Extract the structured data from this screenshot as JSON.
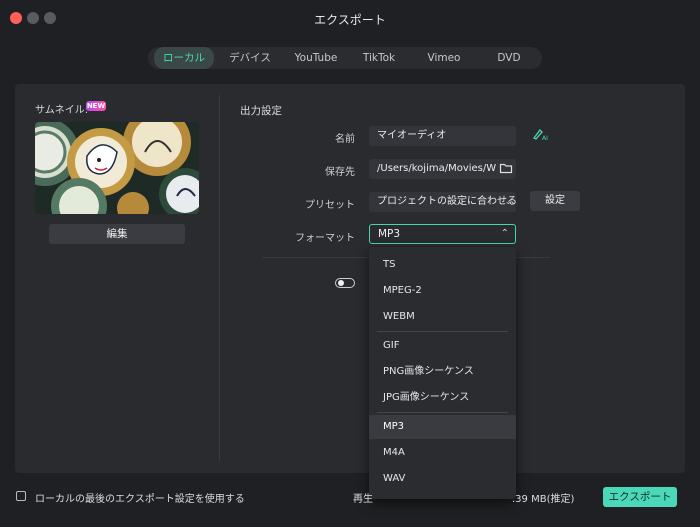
{
  "window": {
    "title": "エクスポート"
  },
  "tabs": [
    {
      "label": "ローカル",
      "active": true
    },
    {
      "label": "デバイス",
      "active": false
    },
    {
      "label": "YouTube",
      "active": false
    },
    {
      "label": "TikTok",
      "active": false
    },
    {
      "label": "Vimeo",
      "active": false
    },
    {
      "label": "DVD",
      "active": false
    }
  ],
  "left_panel": {
    "thumbnail_label": "サムネイル:",
    "new_badge": "NEW",
    "edit_button": "編集",
    "thumbnail_image": "medallion-coins-photo"
  },
  "output": {
    "section_title": "出力設定",
    "name_label": "名前",
    "name_value": "マイオーディオ",
    "save_to_label": "保存先",
    "save_to_value": "/Users/kojima/Movies/W",
    "preset_label": "プリセット",
    "preset_value": "プロジェクトの設定に合わせる",
    "settings_button": "設定",
    "format_label": "フォーマット",
    "format_value": "MP3"
  },
  "format_dropdown": {
    "options": [
      "TS",
      "MPEG-2",
      "WEBM",
      "GIF",
      "PNG画像シーケンス",
      "JPG画像シーケンス",
      "MP3",
      "M4A",
      "WAV"
    ],
    "selected": "MP3"
  },
  "footer": {
    "checkbox_label": "ローカルの最後のエクスポート設定を使用する",
    "playback_prefix": "再生",
    "file_size": ".39 MB(推定)",
    "export_button": "エクスポート"
  },
  "colors": {
    "accent": "#4ad8b8",
    "background": "#1f2023",
    "panel": "#2a2b2f",
    "close": "#ff5f57"
  },
  "icons": [
    "ai-pen-icon",
    "folder-icon",
    "chevron-down-icon",
    "chevron-up-icon"
  ]
}
